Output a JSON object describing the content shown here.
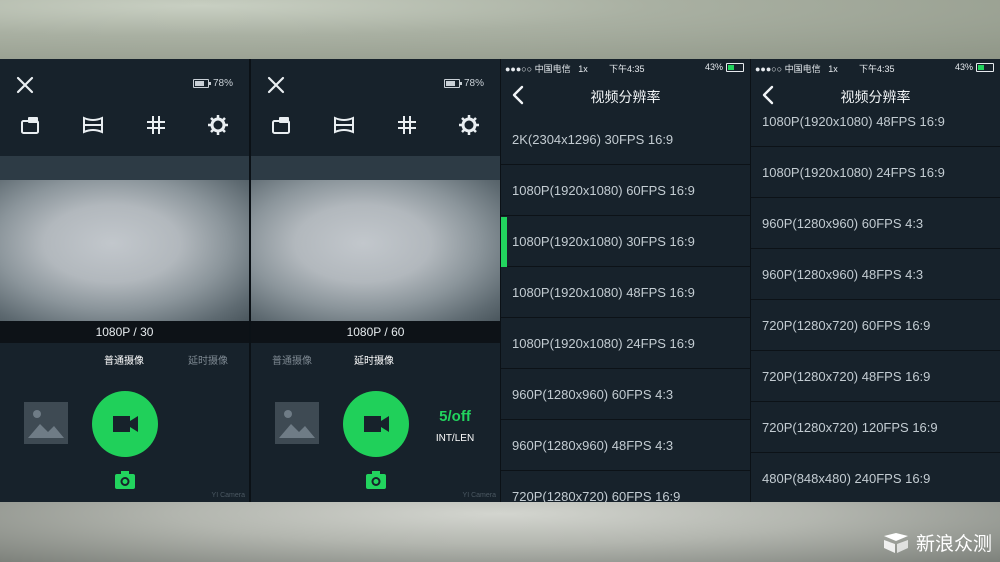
{
  "screens": [
    {
      "battery_percent": "78%",
      "battery_level": 0.78,
      "resolution_label": "1080P / 30",
      "modes": [
        "普通摄像",
        "延时摄像"
      ],
      "active_mode": 0,
      "brand": "YI Camera"
    },
    {
      "battery_percent": "78%",
      "battery_level": 0.78,
      "resolution_label": "1080P / 60",
      "modes": [
        "普通摄像",
        "延时摄像"
      ],
      "active_mode": 1,
      "timelapse_value": "5/off",
      "timelapse_mode": "INT/LEN",
      "brand": "YI Camera"
    }
  ],
  "status_bar": {
    "carrier": "●●●○○ 中国电信",
    "network": "1x",
    "time": "下午4:35",
    "battery": "43%",
    "battery_level": 0.43
  },
  "list_title": "视频分辨率",
  "list_a": {
    "selected_index": 2,
    "items": [
      "2K(2304x1296) 30FPS 16:9",
      "1080P(1920x1080) 60FPS 16:9",
      "1080P(1920x1080) 30FPS 16:9",
      "1080P(1920x1080) 48FPS 16:9",
      "1080P(1920x1080) 24FPS 16:9",
      "960P(1280x960) 60FPS 4:3",
      "960P(1280x960) 48FPS 4:3",
      "720P(1280x720) 60FPS 16:9"
    ]
  },
  "list_b": {
    "items": [
      "1080P(1920x1080) 48FPS 16:9",
      "1080P(1920x1080) 24FPS 16:9",
      "960P(1280x960) 60FPS 4:3",
      "960P(1280x960) 48FPS 4:3",
      "720P(1280x720) 60FPS 16:9",
      "720P(1280x720) 48FPS 16:9",
      "720P(1280x720) 120FPS 16:9",
      "480P(848x480) 240FPS 16:9"
    ]
  },
  "watermark": "新浪众测",
  "colors": {
    "accent": "#22d45e",
    "panel": "#17222b",
    "text": "#c3ccd2"
  }
}
